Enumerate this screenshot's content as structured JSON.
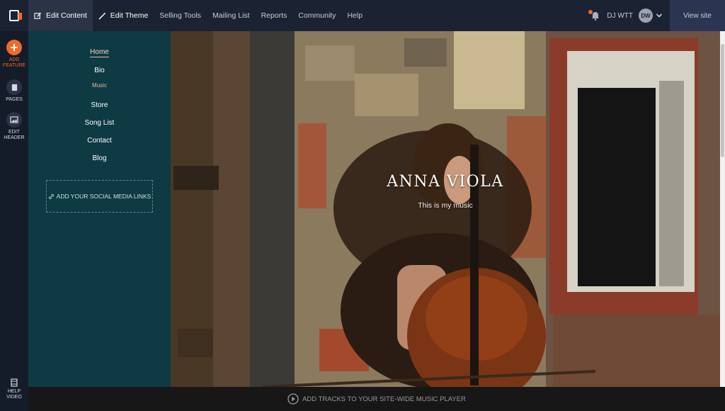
{
  "topbar": {
    "tabs": [
      {
        "label": "Edit Content",
        "icon": "edit-icon"
      },
      {
        "label": "Edit Theme",
        "icon": "brush-icon"
      },
      {
        "label": "Selling Tools"
      },
      {
        "label": "Mailing List"
      },
      {
        "label": "Reports"
      },
      {
        "label": "Community"
      },
      {
        "label": "Help"
      }
    ],
    "user_name": "DJ WTT",
    "avatar_initials": "DW",
    "view_site": "View site"
  },
  "rail": {
    "add_feature": "ADD FEATURE",
    "pages": "PAGES",
    "edit_header": "EDIT HEADER",
    "help_video": "HELP VIDEO"
  },
  "nav": {
    "items": [
      {
        "label": "Home"
      },
      {
        "label": "Bio"
      },
      {
        "label": "Music"
      },
      {
        "label": "Store"
      },
      {
        "label": "Song List"
      },
      {
        "label": "Contact"
      },
      {
        "label": "Blog"
      }
    ],
    "social_button": "ADD YOUR SOCIAL MEDIA LINKS"
  },
  "hero": {
    "title": "ANNA VIOLA",
    "subtitle": "This is my music"
  },
  "player": {
    "label": "ADD TRACKS TO YOUR SITE-WIDE MUSIC PLAYER"
  },
  "colors": {
    "accent": "#ef6a2c",
    "topbar": "#1b2332",
    "nav_panel": "#0e3a44"
  }
}
